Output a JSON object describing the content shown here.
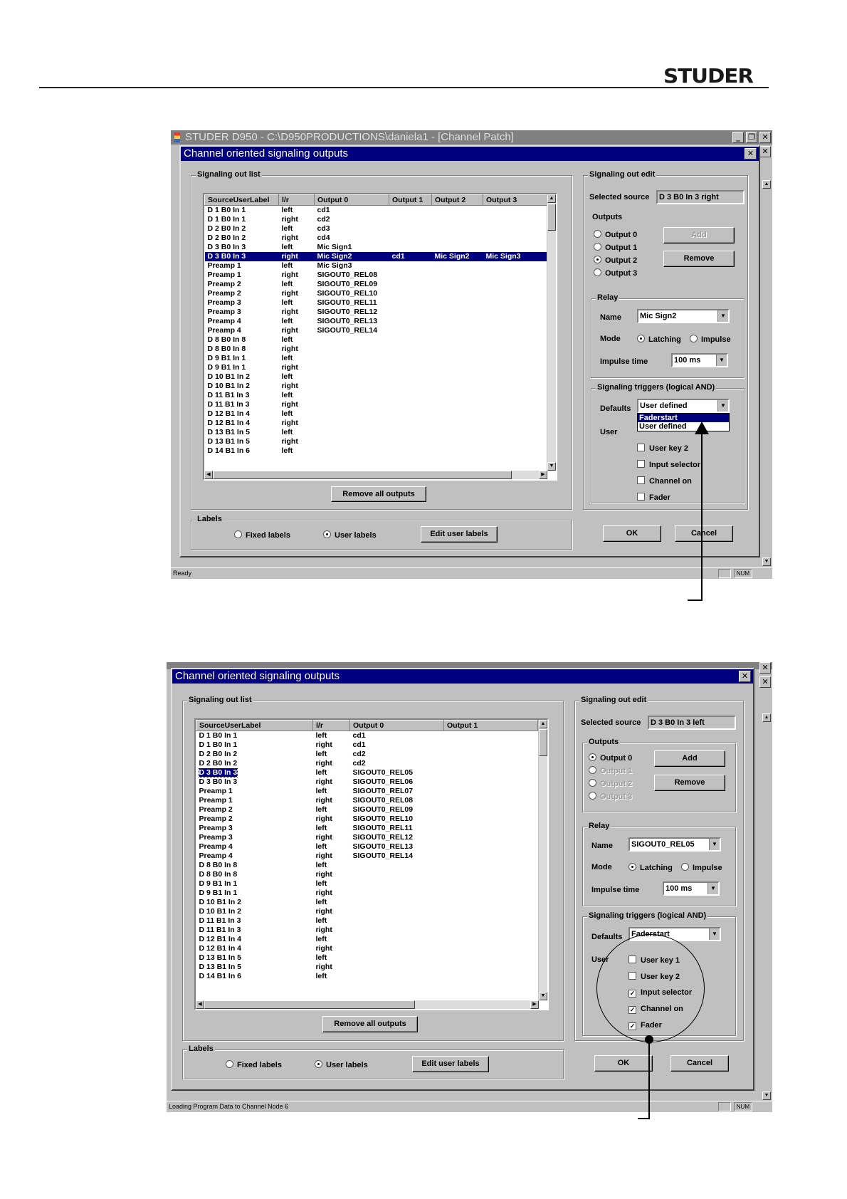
{
  "brand": "STUDER",
  "window_title": "STUDER D950 - C:\\D950PRODUCTIONS\\daniela1 - [Channel Patch]",
  "dialog_title": "Channel oriented signaling outputs",
  "labels": {
    "signaling_out_list": "Signaling out list",
    "signaling_out_edit": "Signaling out edit",
    "selected_source": "Selected source",
    "outputs": "Outputs",
    "relay": "Relay",
    "name": "Name",
    "mode": "Mode",
    "latching": "Latching",
    "impulse": "Impulse",
    "impulse_time": "Impulse time",
    "triggers": "Signaling triggers (logical AND)",
    "defaults": "Defaults",
    "user": "User",
    "labels_group": "Labels",
    "fixed_labels": "Fixed labels",
    "user_labels": "User labels"
  },
  "buttons": {
    "add": "Add",
    "remove": "Remove",
    "remove_all": "Remove all outputs",
    "edit_user_labels": "Edit user labels",
    "ok": "OK",
    "cancel": "Cancel"
  },
  "output_options": [
    "Output 0",
    "Output 1",
    "Output 2",
    "Output 3"
  ],
  "shot1": {
    "columns": [
      "SourceUserLabel",
      "l/r",
      "Output 0",
      "Output 1",
      "Output 2",
      "Output 3"
    ],
    "rows": [
      [
        "D  1   B0 In 1",
        "left",
        "cd1",
        "",
        "",
        ""
      ],
      [
        "D  1   B0 In 1",
        "right",
        "cd2",
        "",
        "",
        ""
      ],
      [
        "D  2   B0 In 2",
        "left",
        "cd3",
        "",
        "",
        ""
      ],
      [
        "D  2   B0 In 2",
        "right",
        "cd4",
        "",
        "",
        ""
      ],
      [
        "D  3   B0 In 3",
        "left",
        "Mic Sign1",
        "",
        "",
        ""
      ],
      [
        "D  3   B0 In 3",
        "right",
        "Mic Sign2",
        "cd1",
        "Mic Sign2",
        "Mic Sign3"
      ],
      [
        "Preamp 1",
        "left",
        "Mic Sign3",
        "",
        "",
        ""
      ],
      [
        "Preamp 1",
        "right",
        "SIGOUT0_REL08",
        "",
        "",
        ""
      ],
      [
        "Preamp 2",
        "left",
        "SIGOUT0_REL09",
        "",
        "",
        ""
      ],
      [
        "Preamp 2",
        "right",
        "SIGOUT0_REL10",
        "",
        "",
        ""
      ],
      [
        "Preamp 3",
        "left",
        "SIGOUT0_REL11",
        "",
        "",
        ""
      ],
      [
        "Preamp 3",
        "right",
        "SIGOUT0_REL12",
        "",
        "",
        ""
      ],
      [
        "Preamp 4",
        "left",
        "SIGOUT0_REL13",
        "",
        "",
        ""
      ],
      [
        "Preamp 4",
        "right",
        "SIGOUT0_REL14",
        "",
        "",
        ""
      ],
      [
        "D  8   B0 In 8",
        "left",
        "",
        "",
        "",
        ""
      ],
      [
        "D  8   B0 In 8",
        "right",
        "",
        "",
        "",
        ""
      ],
      [
        "D  9   B1 In 1",
        "left",
        "",
        "",
        "",
        ""
      ],
      [
        "D  9   B1 In 1",
        "right",
        "",
        "",
        "",
        ""
      ],
      [
        "D 10   B1 In 2",
        "left",
        "",
        "",
        "",
        ""
      ],
      [
        "D 10   B1 In 2",
        "right",
        "",
        "",
        "",
        ""
      ],
      [
        "D 11   B1 In 3",
        "left",
        "",
        "",
        "",
        ""
      ],
      [
        "D 11   B1 In 3",
        "right",
        "",
        "",
        "",
        ""
      ],
      [
        "D 12   B1 In 4",
        "left",
        "",
        "",
        "",
        ""
      ],
      [
        "D 12   B1 In 4",
        "right",
        "",
        "",
        "",
        ""
      ],
      [
        "D 13   B1 In 5",
        "left",
        "",
        "",
        "",
        ""
      ],
      [
        "D 13   B1 In 5",
        "right",
        "",
        "",
        "",
        ""
      ],
      [
        "D 14   B1 In 6",
        "left",
        "",
        "",
        "",
        ""
      ]
    ],
    "selected_row": 5,
    "selected_source": "D  3   B0 In 3 right",
    "selected_output": 2,
    "relay_name": "Mic Sign2",
    "impulse_time": "100 ms",
    "defaults": "User defined",
    "dropdown_options": [
      "Faderstart",
      "User defined"
    ],
    "user_triggers": [
      {
        "label": "User key 2",
        "checked": false
      },
      {
        "label": "Input selector",
        "checked": false
      },
      {
        "label": "Channel on",
        "checked": false
      },
      {
        "label": "Fader",
        "checked": false
      }
    ],
    "status": "Ready",
    "num": "NUM"
  },
  "shot2": {
    "columns": [
      "SourceUserLabel",
      "l/r",
      "Output 0",
      "Output 1"
    ],
    "rows": [
      [
        "D  1   B0 In 1",
        "left",
        "cd1",
        ""
      ],
      [
        "D  1   B0 In 1",
        "right",
        "cd1",
        ""
      ],
      [
        "D  2   B0 In 2",
        "left",
        "cd2",
        ""
      ],
      [
        "D  2   B0 In 2",
        "right",
        "cd2",
        ""
      ],
      [
        "D  3   B0 In 3",
        "left",
        "SIGOUT0_REL05",
        ""
      ],
      [
        "D  3   B0 In 3",
        "right",
        "SIGOUT0_REL06",
        ""
      ],
      [
        "Preamp 1",
        "left",
        "SIGOUT0_REL07",
        ""
      ],
      [
        "Preamp 1",
        "right",
        "SIGOUT0_REL08",
        ""
      ],
      [
        "Preamp 2",
        "left",
        "SIGOUT0_REL09",
        ""
      ],
      [
        "Preamp 2",
        "right",
        "SIGOUT0_REL10",
        ""
      ],
      [
        "Preamp 3",
        "left",
        "SIGOUT0_REL11",
        ""
      ],
      [
        "Preamp 3",
        "right",
        "SIGOUT0_REL12",
        ""
      ],
      [
        "Preamp 4",
        "left",
        "SIGOUT0_REL13",
        ""
      ],
      [
        "Preamp 4",
        "right",
        "SIGOUT0_REL14",
        ""
      ],
      [
        "D  8   B0 In 8",
        "left",
        "",
        ""
      ],
      [
        "D  8   B0 In 8",
        "right",
        "",
        ""
      ],
      [
        "D  9   B1 In 1",
        "left",
        "",
        ""
      ],
      [
        "D  9   B1 In 1",
        "right",
        "",
        ""
      ],
      [
        "D 10   B1 In 2",
        "left",
        "",
        ""
      ],
      [
        "D 10   B1 In 2",
        "right",
        "",
        ""
      ],
      [
        "D 11   B1 In 3",
        "left",
        "",
        ""
      ],
      [
        "D 11   B1 In 3",
        "right",
        "",
        ""
      ],
      [
        "D 12   B1 In 4",
        "left",
        "",
        ""
      ],
      [
        "D 12   B1 In 4",
        "right",
        "",
        ""
      ],
      [
        "D 13   B1 In 5",
        "left",
        "",
        ""
      ],
      [
        "D 13   B1 In 5",
        "right",
        "",
        ""
      ],
      [
        "D 14   B1 In 6",
        "left",
        "",
        ""
      ]
    ],
    "selected_row": 4,
    "selected_source": "D  3   B0 In 3 left",
    "selected_output": 0,
    "relay_name": "SIGOUT0_REL05",
    "impulse_time": "100 ms",
    "defaults": "Faderstart",
    "user_triggers": [
      {
        "label": "User key 1",
        "checked": false
      },
      {
        "label": "User key 2",
        "checked": false
      },
      {
        "label": "Input selector",
        "checked": true
      },
      {
        "label": "Channel on",
        "checked": true
      },
      {
        "label": "Fader",
        "checked": true
      }
    ],
    "status": "Loading Program Data to Channel Node 6",
    "num": "NUM"
  },
  "icons": [
    "app-icon",
    "minimize-icon",
    "restore-icon",
    "close-icon",
    "dropdown-arrow-icon",
    "radio-icon",
    "checkbox-icon",
    "scroll-arrow-icon"
  ]
}
